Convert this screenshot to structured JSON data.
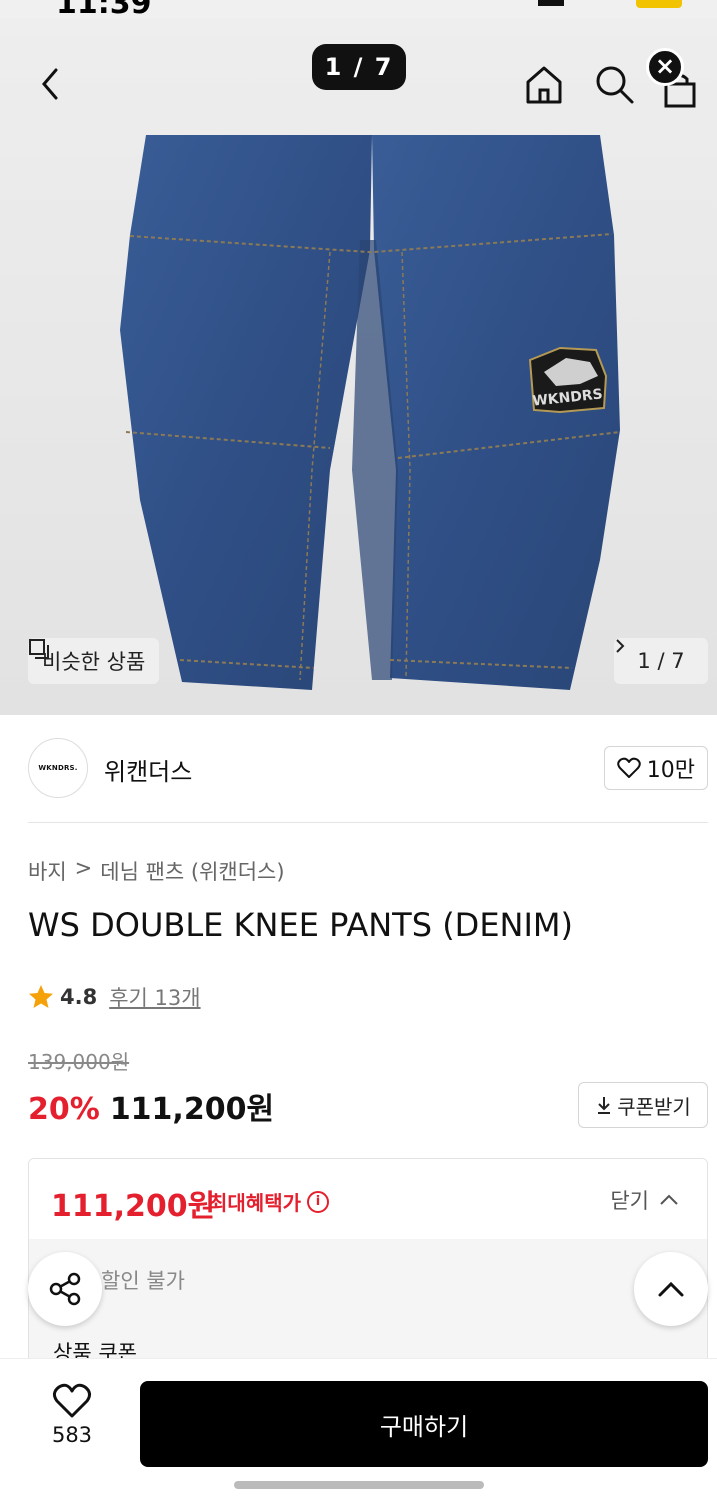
{
  "status_bar": {
    "time": "11:39"
  },
  "gallery": {
    "counter": "1 / 7",
    "similar_label": "비슷한 상품",
    "page_indicator": "1 / 7",
    "patch_text": "WKNDRS"
  },
  "brand": {
    "logo_text": "WKNDRS.",
    "name": "위캔더스",
    "likes": "10만"
  },
  "product": {
    "breadcrumb": [
      "바지",
      ">",
      "데님 팬츠 (위캔더스)"
    ],
    "title": "WS DOUBLE KNEE PANTS (DENIM)",
    "rating": "4.8",
    "review_link": "후기 13개",
    "original_price": "139,000원",
    "discount": "20%",
    "final_price": "111,200원",
    "coupon_button": "쿠폰받기"
  },
  "benefit": {
    "price": "111,200원",
    "label": "최대혜택가",
    "close_label": "닫기",
    "no_discount": "할인 불가",
    "coupon_section": "상품 쿠폰"
  },
  "bottom": {
    "wish_count": "583",
    "buy_label": "구매하기"
  },
  "colors": {
    "accent_red": "#e5202e",
    "denim": "#2f4f86",
    "buy_button": "#000000",
    "star": "#f5a20a"
  }
}
